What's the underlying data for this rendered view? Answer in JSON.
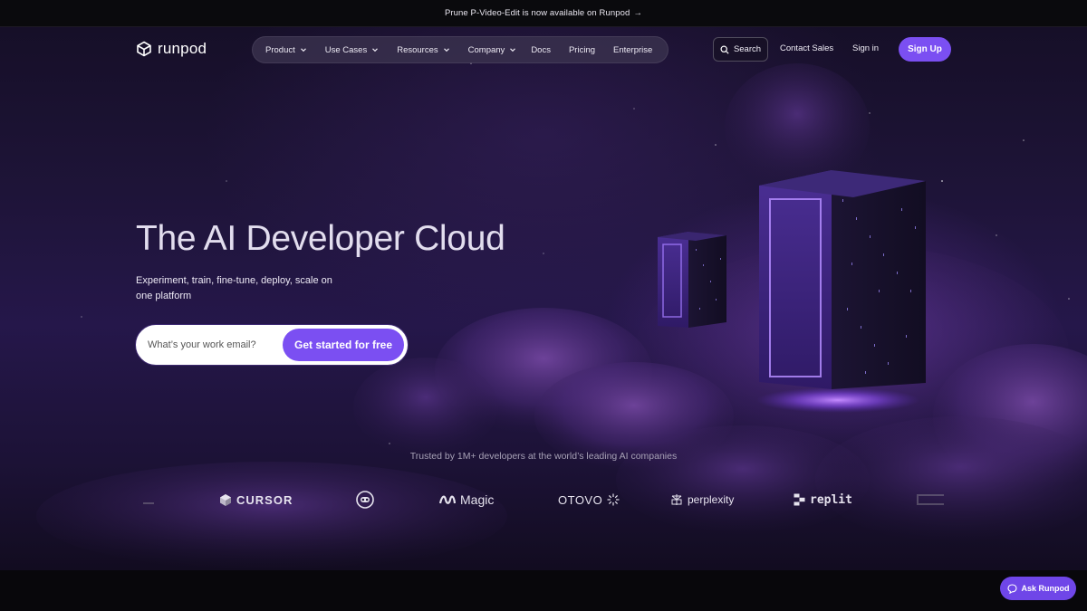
{
  "announcement": {
    "text": "Prune P-Video-Edit is now available on Runpod",
    "arrow": "→"
  },
  "brand": {
    "name": "runpod",
    "accent": "#7b4ff2"
  },
  "nav": {
    "items": [
      {
        "label": "Product",
        "has_dropdown": true
      },
      {
        "label": "Use Cases",
        "has_dropdown": true
      },
      {
        "label": "Resources",
        "has_dropdown": true
      },
      {
        "label": "Company",
        "has_dropdown": true
      },
      {
        "label": "Docs",
        "has_dropdown": false
      },
      {
        "label": "Pricing",
        "has_dropdown": false
      },
      {
        "label": "Enterprise",
        "has_dropdown": false
      }
    ],
    "search_label": "Search",
    "contact_label": "Contact Sales",
    "signin_label": "Sign in",
    "signup_label": "Sign Up"
  },
  "hero": {
    "title": "The AI Developer Cloud",
    "subtitle": "Experiment, train, fine-tune, deploy, scale on one platform",
    "email_placeholder": "What’s your work email?",
    "email_value": "",
    "cta_label": "Get started for free"
  },
  "trusted": {
    "text": "Trusted by 1M+ developers at the world’s leading AI companies",
    "logos": [
      {
        "name": "CURSOR",
        "icon": "cursor-cube-icon"
      },
      {
        "name": "",
        "icon": "astronaut-logo-icon"
      },
      {
        "name": "Magic",
        "icon": "magic-wave-icon"
      },
      {
        "name": "OTOVO",
        "icon": "sunburst-icon"
      },
      {
        "name": "perplexity",
        "icon": "perplexity-icon"
      },
      {
        "name": "replit",
        "icon": "replit-icon"
      }
    ]
  },
  "chat": {
    "label": "Ask Runpod",
    "icon": "chat-bubble-icon"
  }
}
